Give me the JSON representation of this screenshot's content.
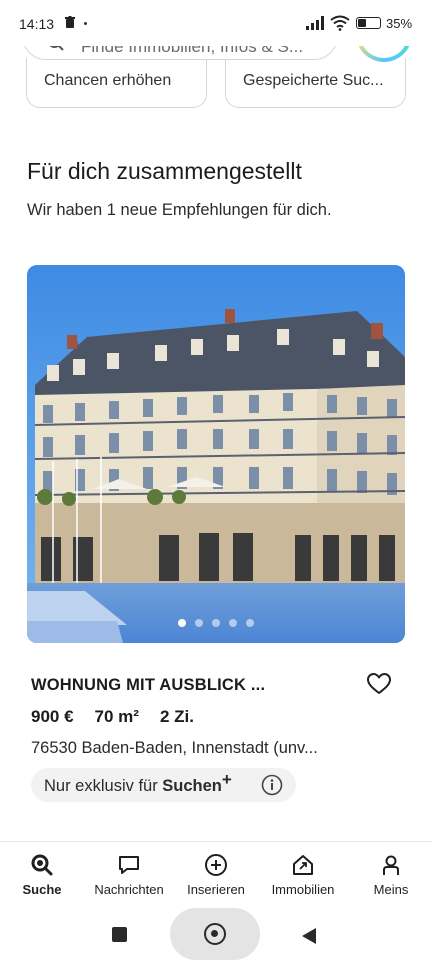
{
  "status_bar": {
    "time": "14:13",
    "battery": "35%"
  },
  "search": {
    "placeholder": "Finde Immobilien, Infos & S..."
  },
  "chips": [
    {
      "label": "Chancen erhöhen"
    },
    {
      "label": "Gespeicherte Suc..."
    }
  ],
  "section": {
    "title": "Für dich zusammengestellt",
    "subtitle": "Wir haben 1 neue Empfehlungen für dich."
  },
  "listing": {
    "carousel": {
      "count": 5,
      "active_index": 0
    },
    "title": "WOHNUNG MIT AUSBLICK ...",
    "price": "900 €",
    "area": "70 m²",
    "rooms": "2 Zi.",
    "address": "76530 Baden-Baden, Innenstadt (unv...",
    "exclusive_prefix": "Nur exklusiv für ",
    "exclusive_brand": "Suchen",
    "exclusive_plus": "+"
  },
  "bottom_nav": [
    {
      "label": "Suche",
      "icon": "search-icon",
      "active": true
    },
    {
      "label": "Nachrichten",
      "icon": "chat-icon",
      "active": false
    },
    {
      "label": "Inserieren",
      "icon": "plus-circle-icon",
      "active": false
    },
    {
      "label": "Immobilien",
      "icon": "house-icon",
      "active": false
    },
    {
      "label": "Meins",
      "icon": "person-icon",
      "active": false
    }
  ],
  "colors": {
    "accent": "#1c1c1c",
    "sky": "#4a90e6",
    "badge_bg": "#f2f2f2"
  }
}
